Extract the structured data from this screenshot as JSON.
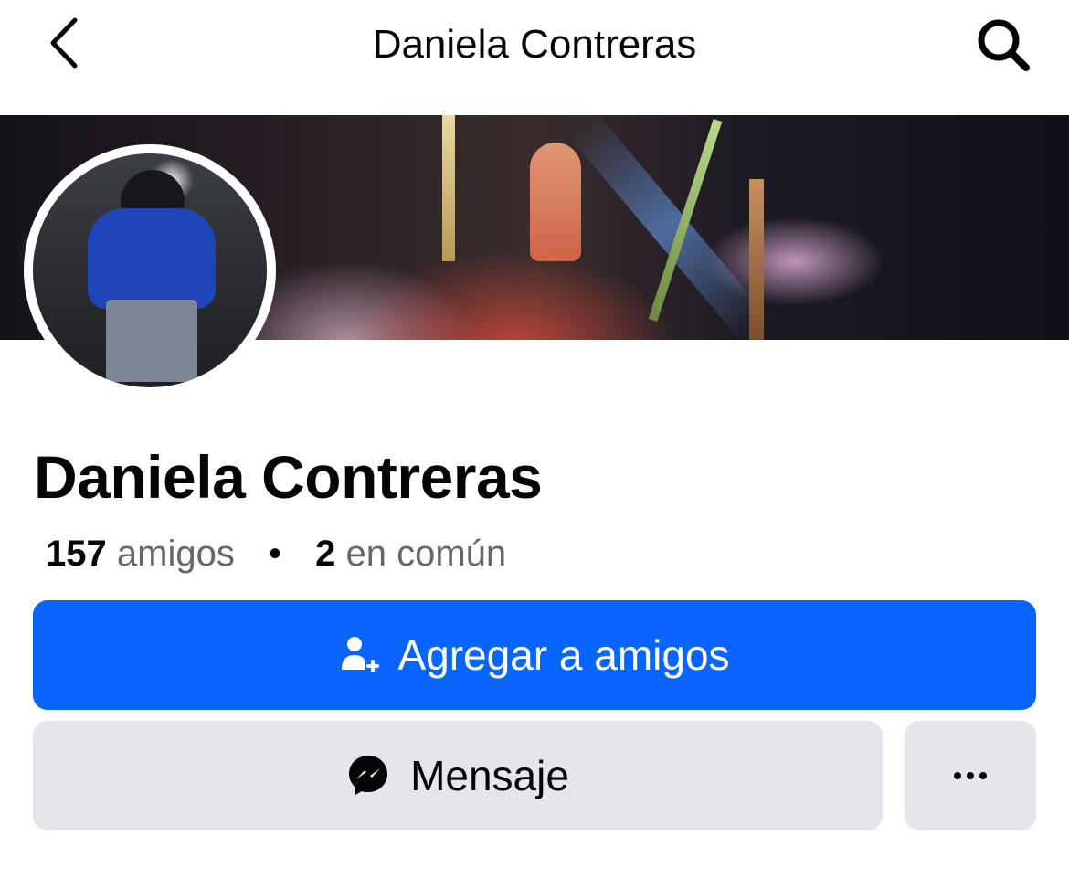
{
  "header": {
    "title": "Daniela Contreras",
    "back_icon": "chevron-left-icon",
    "search_icon": "search-icon"
  },
  "profile": {
    "name": "Daniela Contreras",
    "friends_count": "157",
    "friends_label": "amigos",
    "separator": "•",
    "mutual_count": "2",
    "mutual_label": "en común"
  },
  "actions": {
    "add_friend_label": "Agregar a amigos",
    "add_friend_icon": "add-friend-icon",
    "message_label": "Mensaje",
    "message_icon": "messenger-icon",
    "more_icon": "more-dots-icon"
  },
  "colors": {
    "primary_blue": "#0866ff",
    "secondary_gray": "#e4e6eb",
    "text_primary": "#050505",
    "text_secondary": "#65676b"
  }
}
